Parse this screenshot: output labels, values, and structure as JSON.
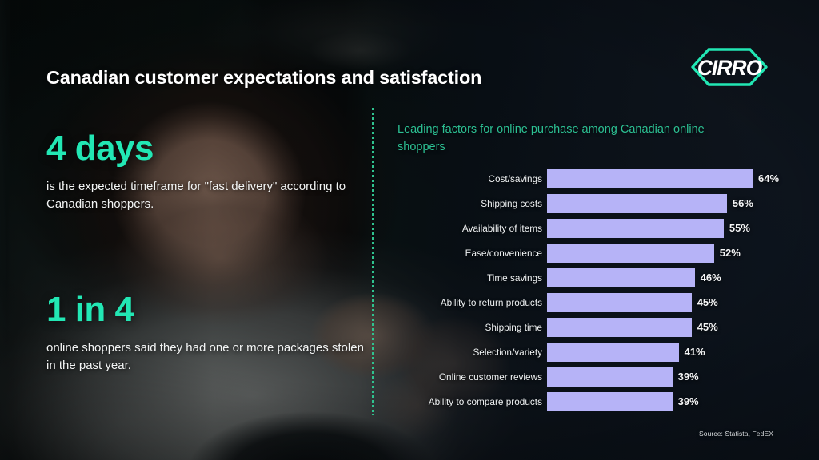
{
  "slide": {
    "title": "Canadian customer expectations and satisfaction",
    "source": "Source: Statista, FedEX",
    "logo_text": "CIRRO",
    "colors": {
      "accent_green": "#22e7b4",
      "subtitle_green": "#2cc093",
      "bar_lavender": "#b6b3f7",
      "divider_green": "#2fc38f",
      "text_white": "#ffffff",
      "background_dark": "#0b1016"
    }
  },
  "stats": [
    {
      "figure": "4 days",
      "description": "is the expected timeframe for \"fast delivery\" according to Canadian shoppers."
    },
    {
      "figure": "1 in 4",
      "description": "online shoppers said they had one or more packages stolen in the past year."
    }
  ],
  "chart_data": {
    "type": "bar",
    "orientation": "horizontal",
    "title": "Leading factors for online purchase among Canadian online shoppers",
    "xlabel": "",
    "ylabel": "",
    "xlim": [
      0,
      64
    ],
    "grid": false,
    "legend": false,
    "unit": "%",
    "categories": [
      "Cost/savings",
      "Shipping costs",
      "Availability of items",
      "Ease/convenience",
      "Time savings",
      "Ability to return products",
      "Shipping time",
      "Selection/variety",
      "Online customer reviews",
      "Ability to compare  products"
    ],
    "values": [
      64,
      56,
      55,
      52,
      46,
      45,
      45,
      41,
      39,
      39
    ],
    "value_labels": [
      "64%",
      "56%",
      "55%",
      "52%",
      "46%",
      "45%",
      "45%",
      "41%",
      "39%",
      "39%"
    ],
    "bar_color": "#b6b3f7",
    "source": "Source: Statista, FedEX"
  }
}
